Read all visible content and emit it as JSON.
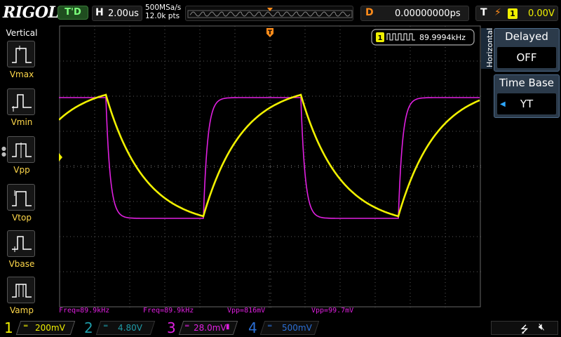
{
  "top_bar": {
    "logo": "RIGOL",
    "run_status": "T'D",
    "horizontal": {
      "label": "H",
      "timebase": "2.00us"
    },
    "sampling": {
      "rate": "500MSa/s",
      "points": "12.0k pts"
    },
    "delay": {
      "label": "D",
      "value": "0.00000000ps"
    },
    "trigger": {
      "label": "T",
      "edge_icon": "rising-edge-icon",
      "source": "1",
      "level": "0.00V"
    }
  },
  "left_panel": {
    "title": "Vertical",
    "items": [
      {
        "label": "Vmax",
        "icon": "vmax-icon"
      },
      {
        "label": "Vmin",
        "icon": "vmin-icon"
      },
      {
        "label": "Vpp",
        "icon": "vpp-icon"
      },
      {
        "label": "Vtop",
        "icon": "vtop-icon"
      },
      {
        "label": "Vbase",
        "icon": "vbase-icon"
      },
      {
        "label": "Vamp",
        "icon": "vamp-icon"
      }
    ]
  },
  "screen": {
    "counter": {
      "channel": "1",
      "value": "89.9994kHz"
    },
    "trigger_marker": "T",
    "ch1_marker": "1",
    "trigger_level_marker": "T"
  },
  "right_menu": {
    "tab_label": "Horizontal",
    "delayed": {
      "title": "Delayed",
      "value": "OFF"
    },
    "time_base": {
      "title": "Time Base",
      "value": "YT"
    }
  },
  "measurements": [
    {
      "text": "Freq=89.9kHz"
    },
    {
      "text": "Freq=89.9kHz"
    },
    {
      "text": "Vpp=816mV"
    },
    {
      "text": "Vpp=99.7mV"
    }
  ],
  "channels": [
    {
      "num": "1",
      "scale": "200mV",
      "color": "#f0f000",
      "active": true
    },
    {
      "num": "2",
      "scale": "4.80V",
      "color": "#1f9ba8",
      "active": false
    },
    {
      "num": "3",
      "scale": "28.0mV",
      "color": "#e020e0",
      "active": true
    },
    {
      "num": "4",
      "scale": "500mV",
      "color": "#2b6fd6",
      "active": false
    }
  ],
  "colors": {
    "ch1": "#f0f000",
    "ch3": "#e020e0",
    "trigger": "#ff8c1a",
    "grid": "#555555",
    "accent": "#2ea8ff"
  }
}
